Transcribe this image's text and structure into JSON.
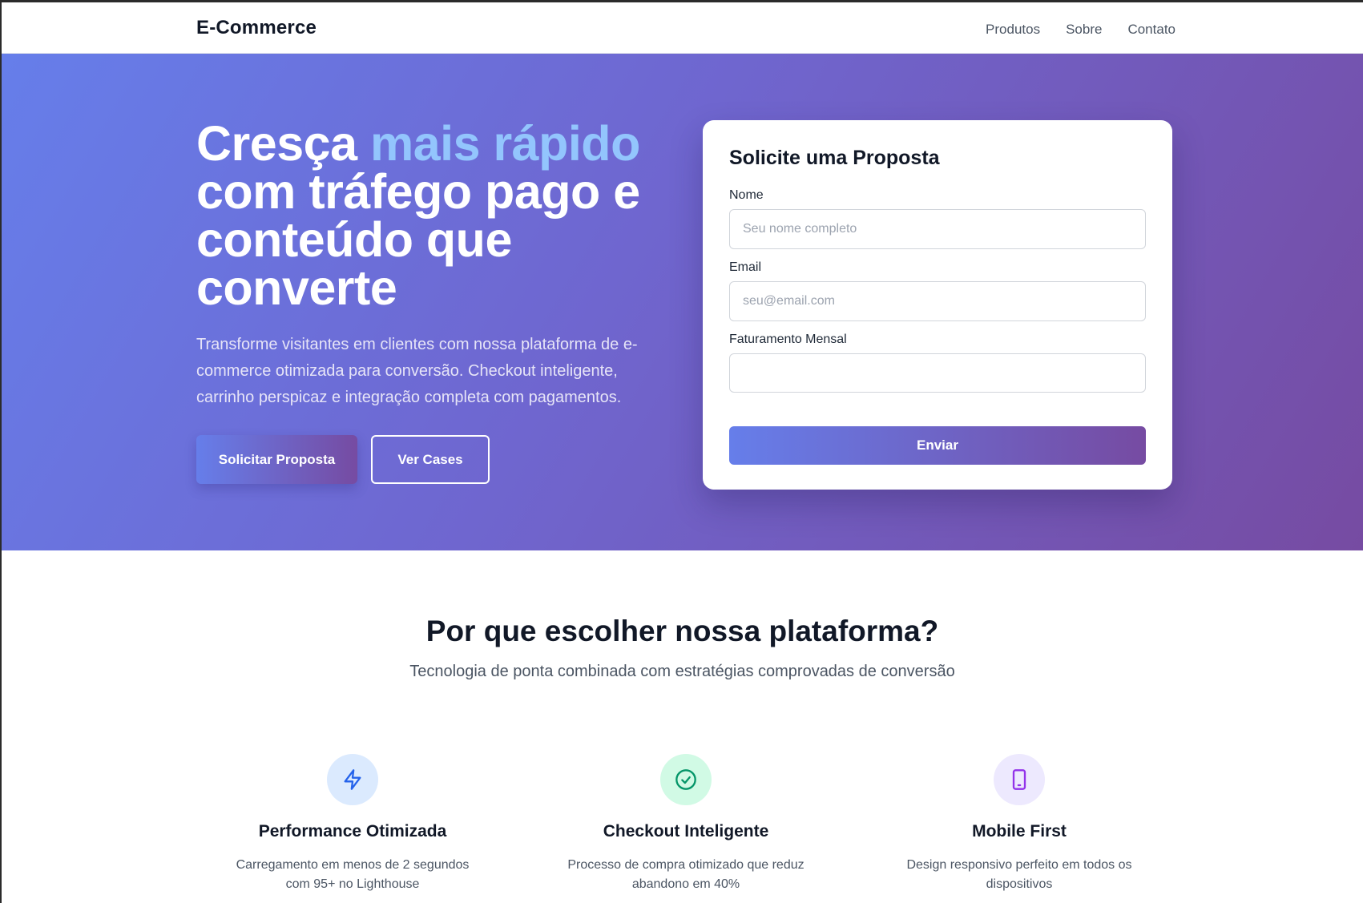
{
  "header": {
    "brand": "E-Commerce",
    "nav": [
      "Produtos",
      "Sobre",
      "Contato"
    ]
  },
  "hero": {
    "title_part1": "Cresça ",
    "title_accent": "mais rápido",
    "title_part2": " com tráfego pago e conteúdo que converte",
    "subtitle": "Transforme visitantes em clientes com nossa plataforma de e-commerce otimizada para conversão. Checkout inteligente, carrinho perspicaz e integração completa com pagamentos.",
    "primary_cta": "Solicitar Proposta",
    "secondary_cta": "Ver Cases"
  },
  "form": {
    "title": "Solicite uma Proposta",
    "name_label": "Nome",
    "name_placeholder": "Seu nome completo",
    "email_label": "Email",
    "email_placeholder": "seu@email.com",
    "revenue_label": "Faturamento Mensal",
    "revenue_value": "",
    "submit_label": "Enviar"
  },
  "features": {
    "title": "Por que escolher nossa plataforma?",
    "subtitle": "Tecnologia de ponta combinada com estratégias comprovadas de conversão",
    "items": [
      {
        "icon": "lightning-icon",
        "title": "Performance Otimizada",
        "description": "Carregamento em menos de 2 segundos com 95+ no Lighthouse"
      },
      {
        "icon": "check-circle-icon",
        "title": "Checkout Inteligente",
        "description": "Processo de compra otimizado que reduz abandono em 40%"
      },
      {
        "icon": "smartphone-icon",
        "title": "Mobile First",
        "description": "Design responsivo perfeito em todos os dispositivos"
      }
    ]
  },
  "colors": {
    "gradient_start": "#667eea",
    "gradient_end": "#764ba2",
    "accent_text": "#93c5fd"
  }
}
